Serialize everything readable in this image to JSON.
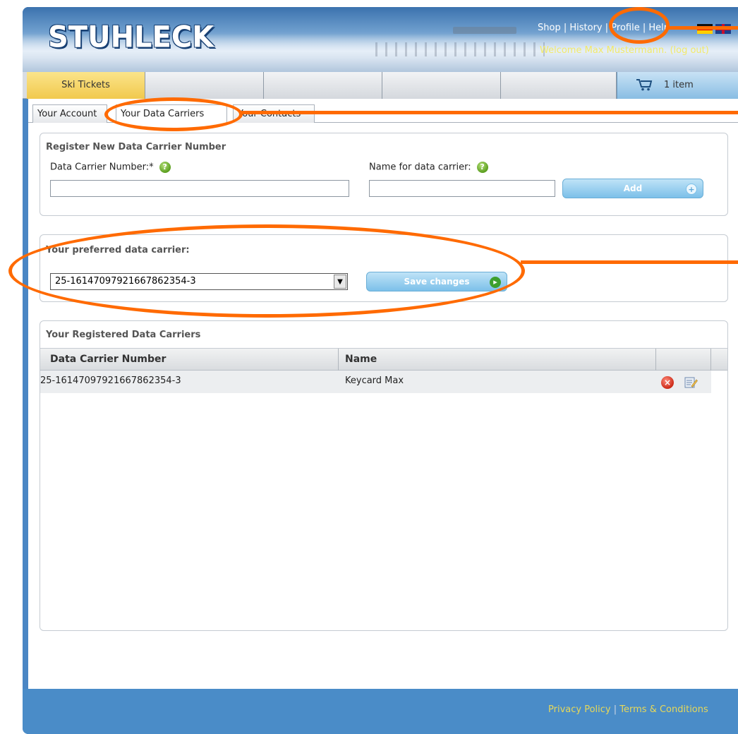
{
  "header": {
    "logo_text": "STUHLECK",
    "top_links": [
      "Shop",
      "History",
      "Profile",
      "Help"
    ],
    "top_links_separator": "|",
    "welcome_text": "Welcome Max Mustermann.",
    "logout_text": "(log out)"
  },
  "nav": {
    "tabs": [
      {
        "label": "Ski Tickets",
        "active": true
      },
      {
        "label": ""
      },
      {
        "label": ""
      },
      {
        "label": ""
      },
      {
        "label": ""
      }
    ],
    "cart_label": "1 item"
  },
  "subtabs": [
    {
      "label": "Your Account"
    },
    {
      "label": "Your Data Carriers",
      "active": true
    },
    {
      "label": "Your Contacts"
    }
  ],
  "register": {
    "title": "Register New Data Carrier Number",
    "number_label": "Data Carrier Number:*",
    "name_label": "Name for data carrier:",
    "number_value": "",
    "name_value": "",
    "add_button": "Add"
  },
  "preferred": {
    "title": "Your preferred data carrier:",
    "selected": "25-16147097921667862354-3",
    "save_button": "Save changes"
  },
  "registered": {
    "title": "Your Registered Data Carriers",
    "columns": [
      "Data Carrier Number",
      "Name"
    ],
    "rows": [
      {
        "number": "25-16147097921667862354-3",
        "name": "Keycard Max"
      }
    ]
  },
  "footer": {
    "privacy": "Privacy Policy",
    "separator": "|",
    "terms": "Terms & Conditions"
  },
  "colors": {
    "annotation": "#ff6a00",
    "frame_blue": "#4a86c4",
    "active_tab": "#f1c94d",
    "welcome_text": "#f2e96a"
  }
}
